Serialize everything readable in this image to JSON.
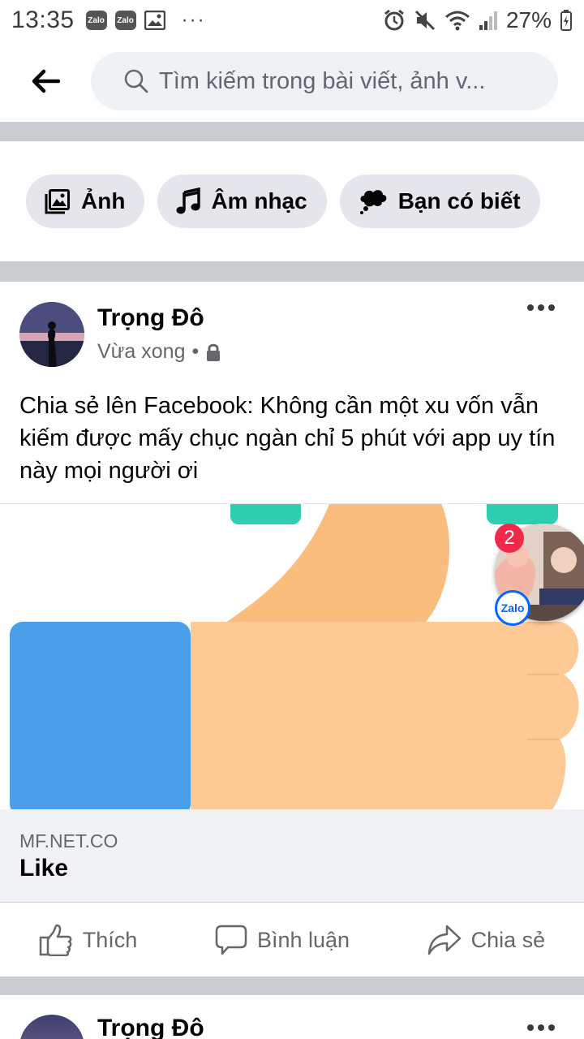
{
  "status_bar": {
    "time": "13:35",
    "battery": "27%",
    "notification_zalo_1": "Zalo",
    "notification_zalo_2": "Zalo",
    "more": "···"
  },
  "search": {
    "placeholder": "Tìm kiếm trong bài viết, ảnh v..."
  },
  "chips": [
    {
      "label": "Ảnh",
      "icon": "photo-icon"
    },
    {
      "label": "Âm nhạc",
      "icon": "music-note-icon"
    },
    {
      "label": "Bạn có biết",
      "icon": "thought-bubble-icon"
    }
  ],
  "post": {
    "author": "Trọng Đô",
    "time": "Vừa xong",
    "separator": "•",
    "privacy_icon": "lock-icon",
    "text": "Chia sẻ lên Facebook: Không cần một xu vốn vẫn kiếm được mấy chục ngàn chỉ 5 phút với app uy tín này mọi người ơi",
    "link": {
      "domain": "MF.NET.CO",
      "title": "Like"
    },
    "actions": {
      "like": "Thích",
      "comment": "Bình luận",
      "share": "Chia sẻ"
    }
  },
  "post2": {
    "author": "Trọng Đô"
  },
  "chathead": {
    "badge": "2",
    "app": "Zalo"
  },
  "colors": {
    "chip_bg": "#e4e6eb",
    "divider": "#c9ccd1",
    "thumb_blue": "#4a9fe8",
    "thumb_skin": "#fdca96",
    "thumb_teal": "#2ecfb1",
    "badge_red": "#f02849",
    "zalo_blue": "#0068ff"
  }
}
